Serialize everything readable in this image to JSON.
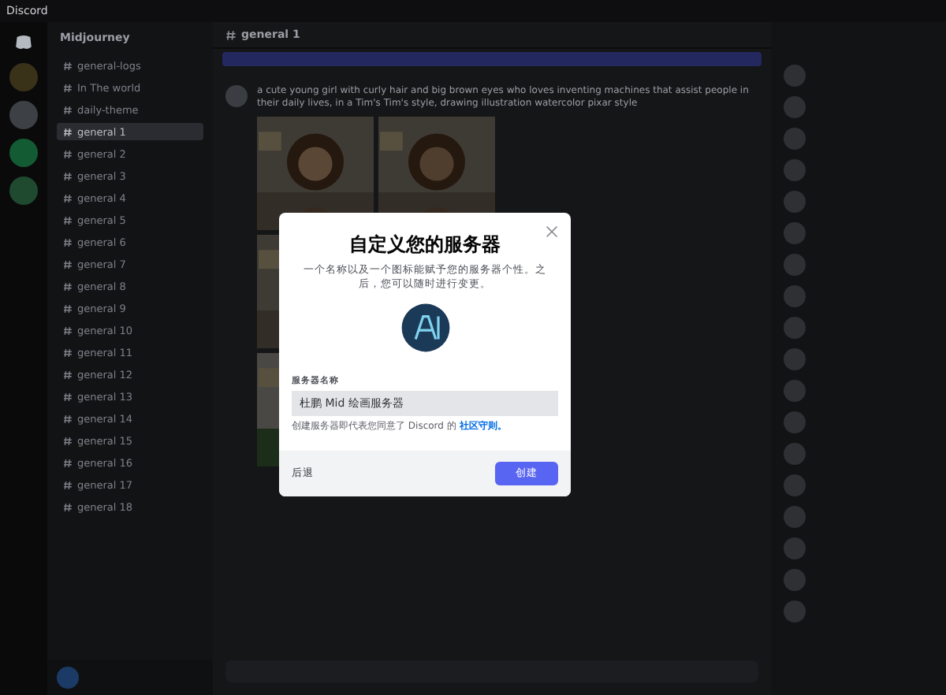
{
  "window": {
    "title": "Discord"
  },
  "server_name": "Midjourney",
  "channels": [
    {
      "name": "general-logs",
      "kind": "channel",
      "selected": false
    },
    {
      "name": "In The world",
      "kind": "channel",
      "selected": false
    },
    {
      "name": "daily-theme",
      "kind": "channel",
      "selected": false
    },
    {
      "name": "general 1",
      "kind": "channel",
      "selected": true
    },
    {
      "name": "general 2",
      "kind": "channel",
      "selected": false
    },
    {
      "name": "general 3",
      "kind": "channel",
      "selected": false
    },
    {
      "name": "general 4",
      "kind": "channel",
      "selected": false
    },
    {
      "name": "general 5",
      "kind": "channel",
      "selected": false
    },
    {
      "name": "general 6",
      "kind": "channel",
      "selected": false
    },
    {
      "name": "general 7",
      "kind": "channel",
      "selected": false
    },
    {
      "name": "general 8",
      "kind": "channel",
      "selected": false
    },
    {
      "name": "general 9",
      "kind": "channel",
      "selected": false
    },
    {
      "name": "general 10",
      "kind": "channel",
      "selected": false
    },
    {
      "name": "general 11",
      "kind": "channel",
      "selected": false
    },
    {
      "name": "general 12",
      "kind": "channel",
      "selected": false
    },
    {
      "name": "general 13",
      "kind": "channel",
      "selected": false
    },
    {
      "name": "general 14",
      "kind": "channel",
      "selected": false
    },
    {
      "name": "general 15",
      "kind": "channel",
      "selected": false
    },
    {
      "name": "general 16",
      "kind": "channel",
      "selected": false
    },
    {
      "name": "general 17",
      "kind": "channel",
      "selected": false
    },
    {
      "name": "general 18",
      "kind": "channel",
      "selected": false
    }
  ],
  "channel_header": {
    "title": "general 1"
  },
  "message": {
    "text": "a cute young girl with curly hair and big brown eyes who loves inventing machines that assist people in their daily lives, in a Tim's Tim's style, drawing illustration watercolor pixar style"
  },
  "dialog": {
    "title": "自定义您的服务器",
    "description": "一个名称以及一个图标能赋予您的服务器个性。之后，您可以随时进行变更。",
    "field_label": "服务器名称",
    "field_value": "杜鹏 Mid 绘画服务器",
    "note": "创建服务器即代表您同意了 Discord 的",
    "note_link": "社区守则。",
    "back_button": "后退",
    "create_button": "创建"
  }
}
